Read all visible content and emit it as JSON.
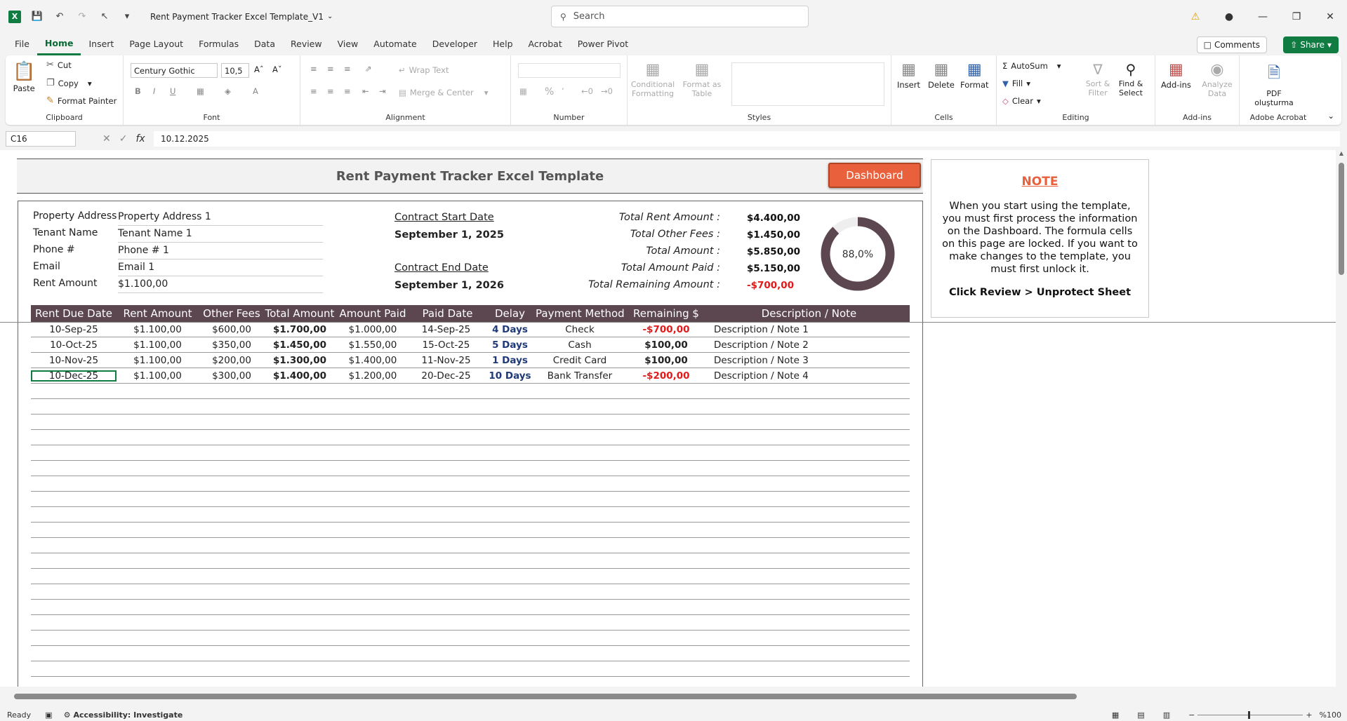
{
  "window": {
    "title": "Rent Payment Tracker Excel Template_V1",
    "search_placeholder": "Search"
  },
  "menu": [
    "File",
    "Home",
    "Insert",
    "Page Layout",
    "Formulas",
    "Data",
    "Review",
    "View",
    "Automate",
    "Developer",
    "Help",
    "Acrobat",
    "Power Pivot"
  ],
  "menu_active": "Home",
  "actions": {
    "comments": "Comments",
    "share": "Share"
  },
  "ribbon": {
    "clipboard": {
      "label": "Clipboard",
      "paste": "Paste",
      "cut": "Cut",
      "copy": "Copy",
      "format_painter": "Format Painter"
    },
    "font": {
      "label": "Font",
      "family": "Century Gothic",
      "size": "10,5"
    },
    "alignment": {
      "label": "Alignment",
      "wrap_text": "Wrap Text",
      "merge_center": "Merge & Center"
    },
    "number": {
      "label": "Number",
      "format": ""
    },
    "styles": {
      "label": "Styles",
      "conditional_formatting": "Conditional Formatting",
      "format_as_table": "Format as Table"
    },
    "cells": {
      "label": "Cells",
      "insert": "Insert",
      "delete": "Delete",
      "format": "Format"
    },
    "editing": {
      "label": "Editing",
      "autosum": "AutoSum",
      "fill": "Fill",
      "clear": "Clear",
      "sort_filter": "Sort & Filter",
      "find_select": "Find & Select"
    },
    "addins": {
      "label": "Add-ins",
      "addins": "Add-ins",
      "analyze_data": "Analyze Data"
    },
    "acrobat": {
      "label": "Adobe Acrobat",
      "pdf": "PDF oluşturma"
    }
  },
  "formula_bar": {
    "cell_ref": "C16",
    "value": "10.12.2025"
  },
  "sheet": {
    "title": "Rent Payment Tracker Excel Template",
    "dashboard_button": "Dashboard",
    "info": [
      {
        "label": "Property Address",
        "value": "Property Address 1"
      },
      {
        "label": "Tenant Name",
        "value": "Tenant Name 1"
      },
      {
        "label": "Phone #",
        "value": "Phone # 1"
      },
      {
        "label": "Email",
        "value": "Email 1"
      },
      {
        "label": "Rent Amount",
        "value": "$1.100,00"
      }
    ],
    "contract": {
      "start_label": "Contract Start Date",
      "start_value": "September 1, 2025",
      "end_label": "Contract End Date",
      "end_value": "September 1, 2026"
    },
    "summary": [
      {
        "label": "Total Rent Amount :",
        "value": "$4.400,00"
      },
      {
        "label": "Total Other Fees :",
        "value": "$1.450,00"
      },
      {
        "label": "Total Amount :",
        "value": "$5.850,00"
      },
      {
        "label": "Total Amount Paid :",
        "value": "$5.150,00"
      },
      {
        "label": "Total Remaining Amount :",
        "value": "-$700,00"
      }
    ],
    "gauge": {
      "label": "88,0%",
      "fraction": 0.88,
      "color": "#5c4650",
      "track": "#eeeeee"
    },
    "table": {
      "headers": [
        "Rent Due Date",
        "Rent Amount",
        "Other Fees",
        "Total Amount",
        "Amount Paid",
        "Paid Date",
        "Delay",
        "Payment Method",
        "Remaining $",
        "Description / Note"
      ],
      "rows": [
        [
          "10-Sep-25",
          "$1.100,00",
          "$600,00",
          "$1.700,00",
          "$1.000,00",
          "14-Sep-25",
          "4 Days",
          "Check",
          "-$700,00",
          "Description / Note 1"
        ],
        [
          "10-Oct-25",
          "$1.100,00",
          "$350,00",
          "$1.450,00",
          "$1.550,00",
          "15-Oct-25",
          "5 Days",
          "Cash",
          "$100,00",
          "Description / Note 2"
        ],
        [
          "10-Nov-25",
          "$1.100,00",
          "$200,00",
          "$1.300,00",
          "$1.400,00",
          "11-Nov-25",
          "1 Days",
          "Credit Card",
          "$100,00",
          "Description / Note 3"
        ],
        [
          "10-Dec-25",
          "$1.100,00",
          "$300,00",
          "$1.400,00",
          "$1.200,00",
          "20-Dec-25",
          "10 Days",
          "Bank Transfer",
          "-$200,00",
          "Description / Note 4"
        ]
      ],
      "empty_rows": 19
    },
    "note": {
      "title": "NOTE",
      "body": "When you start using the template, you must first process the information on the Dashboard. The formula cells on this page are locked. If you want to make changes to the template, you must first unlock it.",
      "footer": "Click Review > Unprotect Sheet"
    }
  },
  "status": {
    "ready": "Ready",
    "accessibility": "Accessibility: Investigate",
    "zoom": "%100"
  },
  "colors": {
    "excel_green": "#107c41",
    "header_bg": "#5c4650",
    "accent_orange": "#e8603c",
    "negative": "#e01b1b",
    "delay_blue": "#1f3a78"
  }
}
